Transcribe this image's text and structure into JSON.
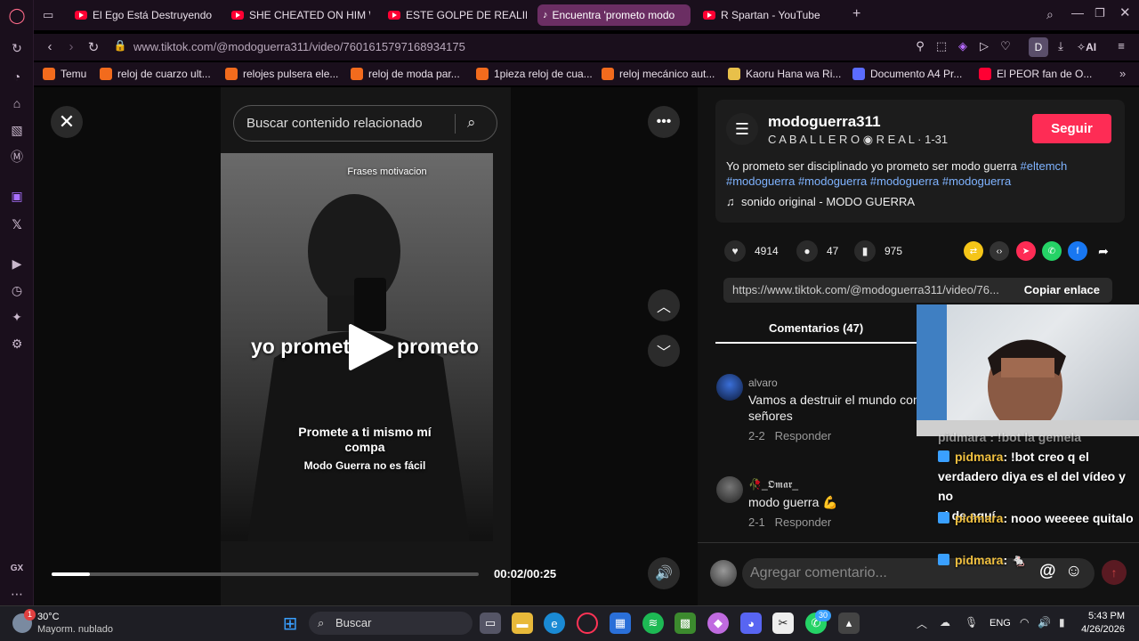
{
  "browser": {
    "tabs": [
      {
        "label": "El Ego Está Destruyendo a",
        "active": false
      },
      {
        "label": "SHE CHEATED ON HIM W",
        "active": false
      },
      {
        "label": "ESTE GOLPE DE REALIDAD",
        "active": false
      },
      {
        "label": "Encuentra 'prometo modo",
        "active": true
      },
      {
        "label": "R Spartan - YouTube",
        "active": false
      }
    ],
    "url": "www.tiktok.com/@modoguerra311/video/7601615797168934175",
    "ai_label": "AI",
    "profile_initial": "D",
    "bookmarks": [
      "Temu",
      "reloj de cuarzo ult...",
      "relojes pulsera ele...",
      "reloj de moda par...",
      "1pieza reloj de cua...",
      "reloj mecánico aut...",
      "Kaoru Hana wa Ri...",
      "Documento A4 Pr...",
      "El PEOR fan de O..."
    ],
    "rail_label": "GX"
  },
  "player": {
    "search_placeholder": "Buscar contenido relacionado",
    "overlay_top": "Frases motivacion",
    "overlay_left": "yo promet",
    "overlay_right": "prometo",
    "caption_line1": "Promete a ti mismo mí",
    "caption_line2": "compa",
    "caption_line3": "Modo Guerra no es fácil",
    "time": "00:02/00:25",
    "progress": 0.09
  },
  "author": {
    "username": "modoguerra311",
    "display": "C A B A L L E R O ◉ R E A L",
    "date": "· 1-31",
    "follow_label": "Seguir",
    "description": "Yo prometo ser disciplinado yo prometo ser modo guerra",
    "hashtags": [
      "#eltemch",
      "#modoguerra",
      "#modoguerra",
      "#modoguerra",
      "#modoguerra"
    ],
    "sound": "sonido original - MODO GUERRA"
  },
  "stats": {
    "likes": "4914",
    "comments": "47",
    "saves": "975"
  },
  "link": {
    "url": "https://www.tiktok.com/@modoguerra311/video/76...",
    "copy_label": "Copiar enlace"
  },
  "comments_tab": "Comentarios (47)",
  "comments": [
    {
      "user": "alvaro",
      "text": "Vamos a destruir el mundo con",
      "text2": "señores",
      "meta": "2-2",
      "reply": "Responder"
    },
    {
      "user": "🥀_𝕺𝖒𝖆𝖗_",
      "text": "modo guerra 💪",
      "text2": "",
      "meta": "2-1",
      "reply": "Responder"
    }
  ],
  "comment_input_placeholder": "Agregar comentario...",
  "chat": [
    {
      "user": "pidmara",
      "text": ": !bot creo q el"
    },
    {
      "line": "verdadero diya es el del vídeo y no"
    },
    {
      "line": "el de aquí"
    },
    {
      "user": "pidmara",
      "text": ": nooo weeeee quitalo"
    },
    {
      "user": "pidmara",
      "text": ": 🐁"
    }
  ],
  "chat_partial": "pidmara : !bot la gemela",
  "taskbar": {
    "weather_temp": "30°C",
    "weather_desc": "Mayorm. nublado",
    "weather_badge": "1",
    "search_label": "Buscar",
    "whatsapp_badge": "30",
    "lang": "ENG",
    "time": "5:43 PM",
    "date": "4/26/2026"
  }
}
